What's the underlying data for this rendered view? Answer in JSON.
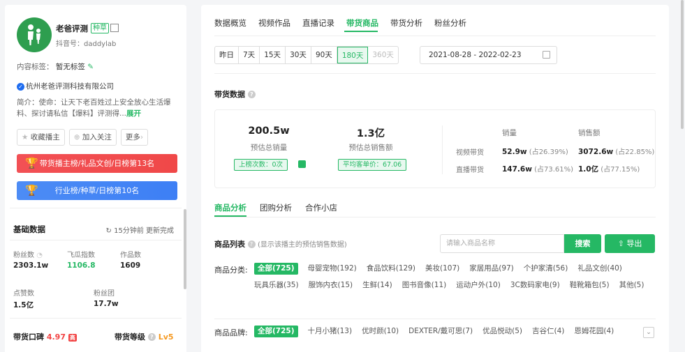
{
  "profile": {
    "name": "老爸评测",
    "tag": "种草",
    "douyin_id": "抖音号：daddylab",
    "content_tag_label": "内容标签：",
    "content_tag_value": "暂无标签",
    "company": "杭州老爸评测科技有限公司",
    "intro": "简介：使命：让天下老百姓过上安全放心生活爆料、探讨请私信【爆料】评测得...",
    "expand": "展开"
  },
  "actions": {
    "favorite": "收藏播主",
    "follow": "加入关注",
    "more": "更多"
  },
  "banners": {
    "red": "带货播主榜/礼品文创/日榜第13名",
    "blue": "行业榜/种草/日榜第10名"
  },
  "basic": {
    "title": "基础数据",
    "update": "15分钟前 更新完成",
    "fans_label": "粉丝数",
    "fans": "2303.1w",
    "feigua_label": "飞瓜指数",
    "feigua": "1106.8",
    "works_label": "作品数",
    "works": "1609",
    "likes_label": "点赞数",
    "likes": "1.5亿",
    "group_label": "粉丝团",
    "group": "17.7w",
    "koubei_label": "带货口碑",
    "koubei": "4.97",
    "koubei_badge": "高",
    "level_label": "带货等级",
    "level": "Lv5"
  },
  "tabs": [
    "数据概览",
    "视频作品",
    "直播记录",
    "带货商品",
    "带货分析",
    "粉丝分析"
  ],
  "ranges": [
    "昨日",
    "7天",
    "15天",
    "30天",
    "90天",
    "180天",
    "360天"
  ],
  "date_range": "2021-08-28  - 2022-02-23",
  "goods": {
    "title": "带货数据",
    "total_sales": "200.5w",
    "total_sales_label": "预估总销量",
    "total_amount": "1.3亿",
    "total_amount_label": "预估总销售额",
    "rank_times": "上榜次数：0次",
    "avg_price": "平均客单价：67.06",
    "col_sales": "销量",
    "col_amount": "销售额",
    "video_label": "视频带货",
    "video_sales": "52.9w",
    "video_sales_pct": "(占26.39%)",
    "video_amount": "3072.6w",
    "video_amount_pct": "(占22.85%)",
    "live_label": "直播带货",
    "live_sales": "147.6w",
    "live_sales_pct": "(占73.61%)",
    "live_amount": "1.0亿",
    "live_amount_pct": "(占77.15%)"
  },
  "subtabs": [
    "商品分析",
    "团购分析",
    "合作小店"
  ],
  "list": {
    "title": "商品列表",
    "hint": "(显示该播主的预估销售数据)",
    "search_placeholder": "请输入商品名称",
    "search_btn": "搜索",
    "export_btn": "导出",
    "category_label": "商品分类:",
    "categories": [
      "全部(725)",
      "母婴宠物(192)",
      "食品饮料(129)",
      "美妆(107)",
      "家居用品(97)",
      "个护家清(56)",
      "礼品文创(40)",
      "玩具乐器(35)",
      "服饰内衣(15)",
      "生鲜(14)",
      "图书音像(11)",
      "运动户外(10)",
      "3C数码家电(9)",
      "鞋靴箱包(5)",
      "其他(5)"
    ],
    "brand_label": "商品品牌:",
    "brands": [
      "全部(725)",
      "十月小猪(13)",
      "优时颜(10)",
      "DEXTER/戴可思(7)",
      "优品悦动(5)",
      "吉谷仁(4)",
      "恩姆花园(4)"
    ]
  }
}
